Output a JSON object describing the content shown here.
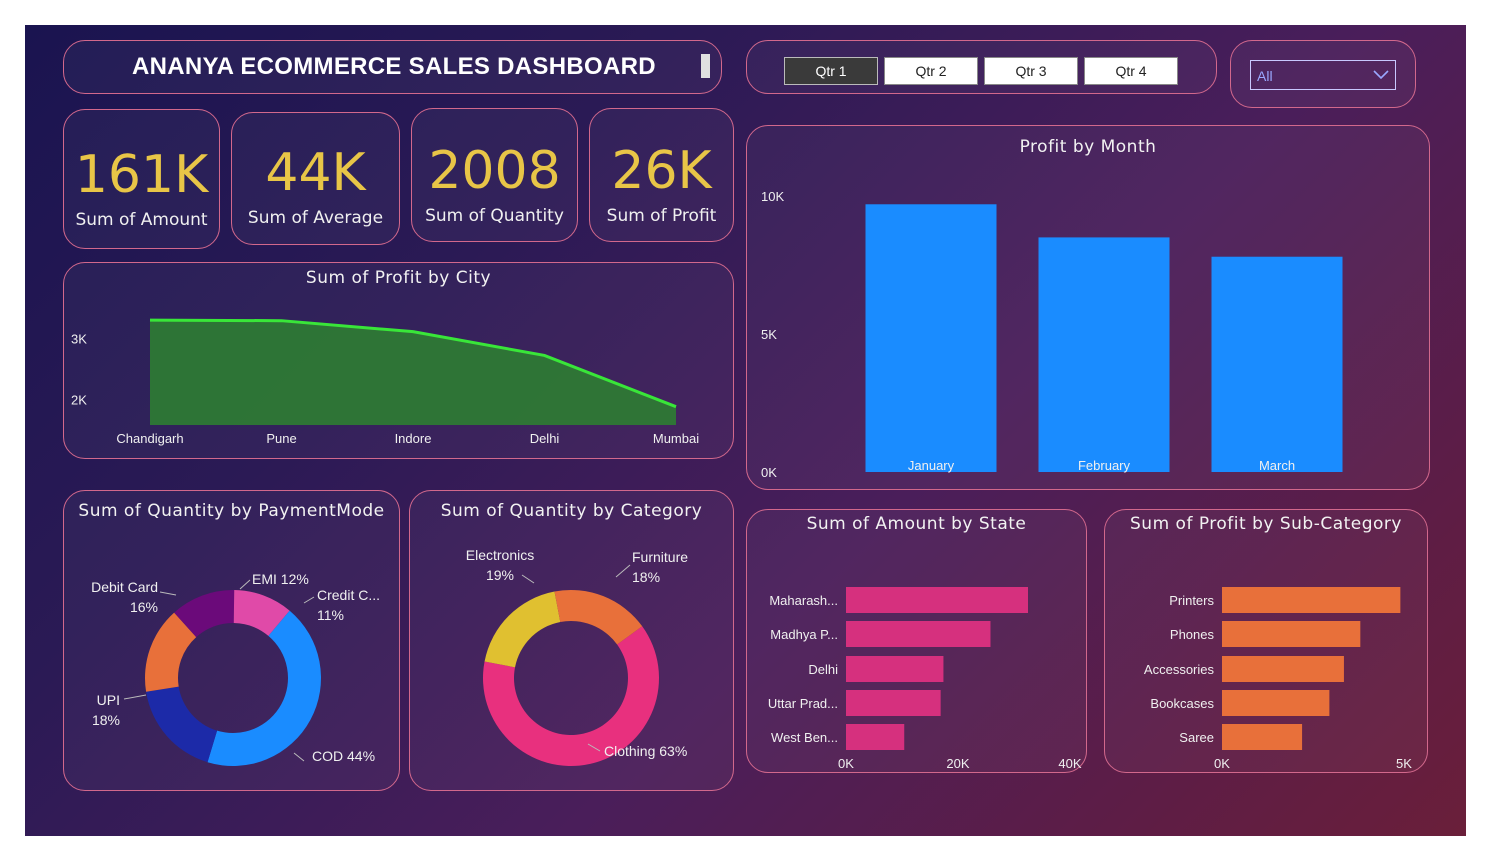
{
  "header": {
    "title": "ANANYA ECOMMERCE SALES DASHBOARD"
  },
  "quarters": [
    {
      "label": "Qtr 1",
      "active": true
    },
    {
      "label": "Qtr 2",
      "active": false
    },
    {
      "label": "Qtr 3",
      "active": false
    },
    {
      "label": "Qtr 4",
      "active": false
    }
  ],
  "filter": {
    "selected": "All"
  },
  "kpis": [
    {
      "value": "161K",
      "label": "Sum of Amount"
    },
    {
      "value": "44K",
      "label": "Sum of Average"
    },
    {
      "value": "2008",
      "label": "Sum of Quantity"
    },
    {
      "value": "26K",
      "label": "Sum of Profit"
    }
  ],
  "colors": {
    "accent_gold": "#e8c547",
    "card_border": "#d2688c",
    "bar_blue": "#1a8cff",
    "bar_pink": "#d6307e",
    "bar_orange": "#e8703a",
    "area_green": "#2e7d32",
    "line_green": "#39e639"
  },
  "chart_data": [
    {
      "id": "profit-by-city",
      "type": "area",
      "title": "Sum of Profit by City",
      "categories": [
        "Chandigarh",
        "Pune",
        "Indore",
        "Delhi",
        "Mumbai"
      ],
      "values": [
        3320,
        3310,
        3130,
        2740,
        1900
      ],
      "yticks": [
        "3K",
        "2K"
      ],
      "ylim": [
        1600,
        3600
      ]
    },
    {
      "id": "profit-by-month",
      "type": "bar",
      "title": "Profit by Month",
      "categories": [
        "January",
        "February",
        "March"
      ],
      "values": [
        9700,
        8500,
        7800
      ],
      "yticks": [
        "10K",
        "5K",
        "0K"
      ],
      "ylim": [
        0,
        10000
      ]
    },
    {
      "id": "quantity-by-paymentmode",
      "type": "pie",
      "title": "Sum of Quantity by PaymentMode",
      "slices": [
        {
          "name": "COD",
          "label": "COD 44%",
          "value": 44,
          "color": "#1a8cff"
        },
        {
          "name": "UPI",
          "label": "UPI\n18%",
          "value": 18,
          "color": "#1c2aa8"
        },
        {
          "name": "Debit Card",
          "label": "Debit Card\n16%",
          "value": 16,
          "color": "#e8703a"
        },
        {
          "name": "EMI",
          "label": "EMI 12%",
          "value": 12,
          "color": "#6b0a7a"
        },
        {
          "name": "Credit C...",
          "label": "Credit C...\n11%",
          "value": 11,
          "color": "#e04aa8"
        }
      ]
    },
    {
      "id": "quantity-by-category",
      "type": "pie",
      "title": "Sum of Quantity by Category",
      "slices": [
        {
          "name": "Clothing",
          "label": "Clothing 63%",
          "value": 63,
          "color": "#e8307e"
        },
        {
          "name": "Electronics",
          "label": "Electronics\n19%",
          "value": 19,
          "color": "#e0c030"
        },
        {
          "name": "Furniture",
          "label": "Furniture\n18%",
          "value": 18,
          "color": "#e8703a"
        }
      ]
    },
    {
      "id": "amount-by-state",
      "type": "bar",
      "orientation": "horizontal",
      "title": "Sum of Amount by State",
      "categories": [
        "Maharash...",
        "Madhya P...",
        "Delhi",
        "Uttar Prad...",
        "West Ben..."
      ],
      "values": [
        32500,
        25800,
        17400,
        16900,
        10400
      ],
      "xticks": [
        "0K",
        "20K",
        "40K"
      ],
      "xlim": [
        0,
        40000
      ]
    },
    {
      "id": "profit-by-subcategory",
      "type": "bar",
      "orientation": "horizontal",
      "title": "Sum of Profit by Sub-Category",
      "categories": [
        "Printers",
        "Phones",
        "Accessories",
        "Bookcases",
        "Saree"
      ],
      "values": [
        4900,
        3800,
        3350,
        2950,
        2200
      ],
      "xticks": [
        "0K",
        "5K"
      ],
      "xlim": [
        0,
        5000
      ]
    }
  ]
}
